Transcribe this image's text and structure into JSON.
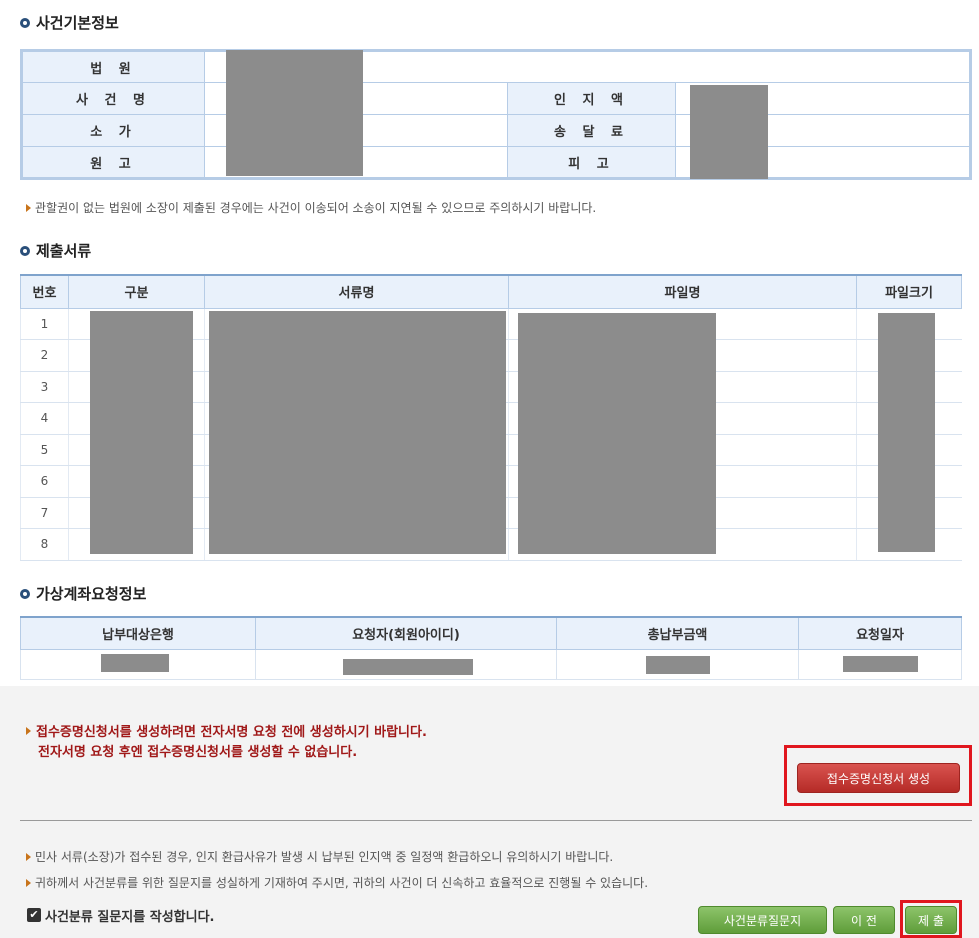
{
  "case_info": {
    "title": "사건기본정보",
    "court_label": "법 원",
    "case_name_label": "사 건 명",
    "stamp_label": "인 지 액",
    "claim_value_label": "소 가",
    "service_fee_label": "송 달 료",
    "plaintiff_label": "원 고",
    "defendant_label": "피 고",
    "jurisdiction_note": "관할권이 없는 법원에 소장이 제출된 경우에는 사건이 이송되어 소송이 지연될 수 있으므로 주의하시기 바랍니다."
  },
  "documents": {
    "title": "제출서류",
    "headers": [
      "번호",
      "구분",
      "서류명",
      "파일명",
      "파일크기"
    ],
    "rows": [
      "1",
      "2",
      "3",
      "4",
      "5",
      "6",
      "7",
      "8"
    ]
  },
  "virtual_account": {
    "title": "가상계좌요청정보",
    "headers": [
      "납부대상은행",
      "요청자(회원아이디)",
      "총납부금액",
      "요청일자"
    ]
  },
  "receipt_warning": {
    "line1": "접수증명신청서를 생성하려면 전자서명 요청 전에 생성하시기 바랍니다.",
    "line2": "전자서명 요청 후엔 접수증명신청서를 생성할 수 없습니다.",
    "button": "접수증명신청서 생성"
  },
  "notices": {
    "refund": "민사 서류(소장)가 접수된 경우, 인지 환급사유가 발생 시 납부된 인지액 중 일정액 환급하오니 유의하시기 바랍니다.",
    "questionnaire": "귀하께서 사건분류를 위한 질문지를 성실하게 기재하여 주시면, 귀하의 사건이 더 신속하고 효율적으로 진행될 수 있습니다."
  },
  "footer": {
    "checkbox_label": "사건분류 질문지를 작성합니다.",
    "questionnaire_button": "사건분류질문지",
    "prev_button": "이 전",
    "submit_button": "제 출"
  }
}
